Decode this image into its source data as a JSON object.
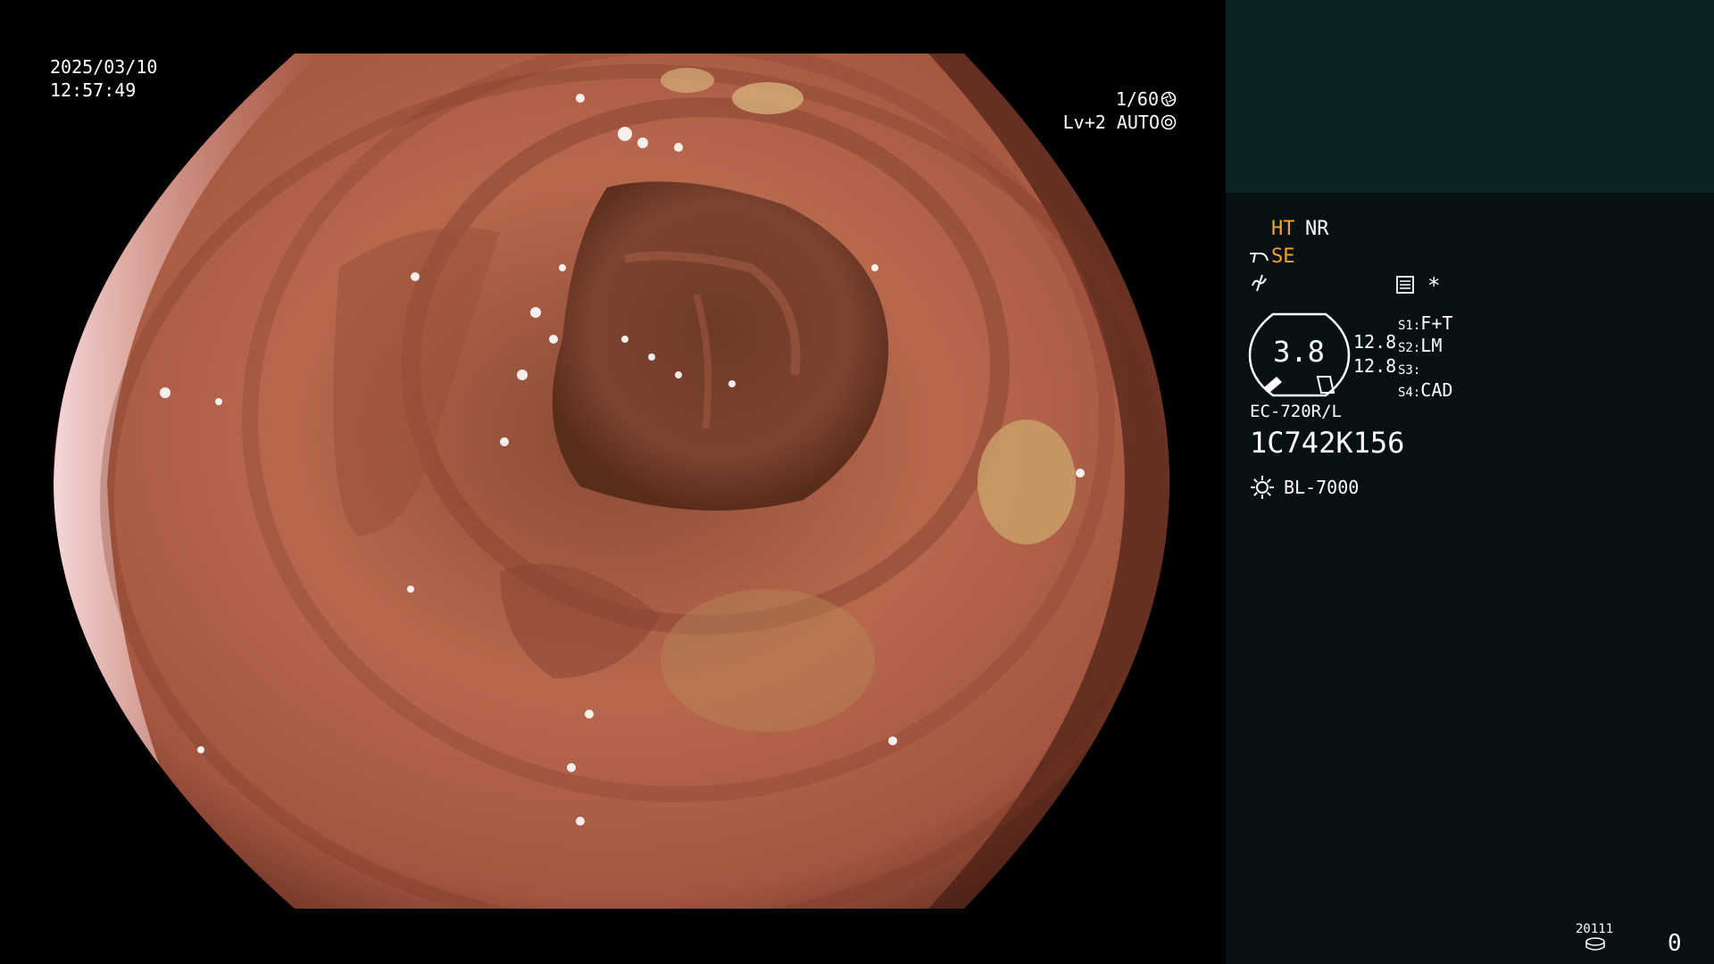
{
  "osd": {
    "date": "2025/03/10",
    "time": "12:57:49",
    "shutter": "1/60",
    "iris_level": "Lv+2",
    "iris_mode": "AUTO"
  },
  "panel": {
    "enhance_1": "HT",
    "enhance_2": "NR",
    "mode_se": "SE",
    "asterisk": "*",
    "gauge_value": "3.8",
    "readout_1": "12.8",
    "readout_2": "12.8",
    "switches": [
      {
        "key": "S1:",
        "value": "F+T"
      },
      {
        "key": "S2:",
        "value": "LM"
      },
      {
        "key": "S3:",
        "value": ""
      },
      {
        "key": "S4:",
        "value": "CAD"
      }
    ],
    "scope_model": "EC-720R/L",
    "scope_serial": "1C742K156",
    "light_source": "BL-7000",
    "storage_count": "20111",
    "counter": "0"
  },
  "colors": {
    "panel_bg": "#071012",
    "preview_bg": "#0c2325",
    "amber": "#f5a623",
    "tissue": "#b0644a"
  },
  "icons": [
    "aperture-icon",
    "iris-icon",
    "scope-icon",
    "wave-icon",
    "settings-icon",
    "sun-icon",
    "disk-icon"
  ]
}
